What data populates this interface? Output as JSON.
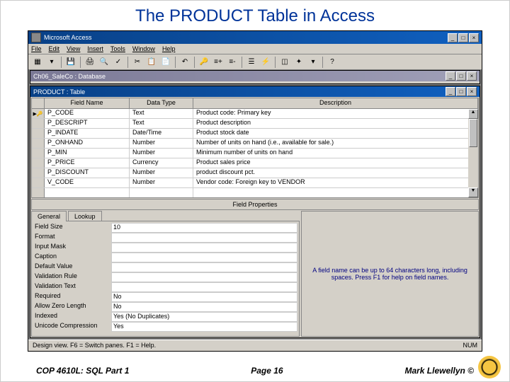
{
  "slide_title": "The PRODUCT Table in Access",
  "app_title": "Microsoft Access",
  "menus": [
    "File",
    "Edit",
    "View",
    "Insert",
    "Tools",
    "Window",
    "Help"
  ],
  "db_window_title": "Ch06_SaleCo : Database",
  "table_window_title": "PRODUCT : Table",
  "columns": {
    "fieldname": "Field Name",
    "datatype": "Data Type",
    "description": "Description"
  },
  "rows": [
    {
      "key": true,
      "name": "P_CODE",
      "type": "Text",
      "desc": "Product code: Primary key"
    },
    {
      "key": false,
      "name": "P_DESCRIPT",
      "type": "Text",
      "desc": "Product description"
    },
    {
      "key": false,
      "name": "P_INDATE",
      "type": "Date/Time",
      "desc": "Product stock date"
    },
    {
      "key": false,
      "name": "P_ONHAND",
      "type": "Number",
      "desc": "Number of units on hand (i.e., available for sale.)"
    },
    {
      "key": false,
      "name": "P_MIN",
      "type": "Number",
      "desc": "Minimum number of units on hand"
    },
    {
      "key": false,
      "name": "P_PRICE",
      "type": "Currency",
      "desc": "Product sales price"
    },
    {
      "key": false,
      "name": "P_DISCOUNT",
      "type": "Number",
      "desc": "product discount pct."
    },
    {
      "key": false,
      "name": "V_CODE",
      "type": "Number",
      "desc": "Vendor code: Foreign key to VENDOR"
    }
  ],
  "props_separator": "Field Properties",
  "tabs": {
    "general": "General",
    "lookup": "Lookup"
  },
  "properties": [
    {
      "label": "Field Size",
      "value": "10"
    },
    {
      "label": "Format",
      "value": ""
    },
    {
      "label": "Input Mask",
      "value": ""
    },
    {
      "label": "Caption",
      "value": ""
    },
    {
      "label": "Default Value",
      "value": ""
    },
    {
      "label": "Validation Rule",
      "value": ""
    },
    {
      "label": "Validation Text",
      "value": ""
    },
    {
      "label": "Required",
      "value": "No"
    },
    {
      "label": "Allow Zero Length",
      "value": "No"
    },
    {
      "label": "Indexed",
      "value": "Yes (No Duplicates)"
    },
    {
      "label": "Unicode Compression",
      "value": "Yes"
    }
  ],
  "help_text": "A field name can be up to 64 characters long, including spaces. Press F1 for help on field names.",
  "status_left": "Design view.  F6 = Switch panes.  F1 = Help.",
  "status_right": "NUM",
  "footer": {
    "left": "COP 4610L: SQL Part 1",
    "center": "Page 16",
    "right": "Mark Llewellyn ©"
  }
}
